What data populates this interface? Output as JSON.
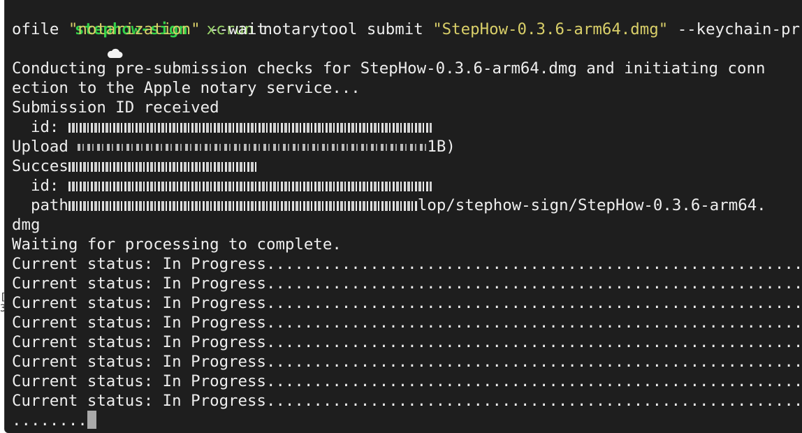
{
  "prompt": {
    "directory": "stephow-sign",
    "command": "xcrun",
    "args": "notarytool submit",
    "dmg_arg": "\"StepHow-0.3.6-arm64.dmg\"",
    "keychain_flag": "--keychain-pr",
    "keychain_flag_cont": "ofile",
    "profile_arg": "\"notarization\"",
    "wait_flag": "--wait"
  },
  "output": {
    "checks_line1": "Conducting pre-submission checks for StepHow-0.3.6-arm64.dmg and initiating conn",
    "checks_line2": "ection to the Apple notary service...",
    "submission_received": "Submission ID received",
    "id_label": "  id: ",
    "upload_label": "Upload ",
    "upload_tail": "1B)",
    "success_label": "Succes",
    "id2_label": "  id: ",
    "path_label": "  path",
    "path_tail": "lop/stephow-sign/StepHow-0.3.6-arm64.",
    "path_cont": "dmg",
    "waiting": "Waiting for processing to complete.",
    "status_lines": [
      "Current status: In Progress.........................................................",
      "Current status: In Progress.........................................................",
      "Current status: In Progress.........................................................",
      "Current status: In Progress.........................................................",
      "Current status: In Progress.........................................................",
      "Current status: In Progress.........................................................",
      "Current status: In Progress.........................................................",
      "Current status: In Progress........................................................."
    ],
    "last_dots": "........"
  },
  "colors": {
    "background": "#1e1e1e",
    "text": "#eeeeee",
    "prompt_dir": "#33d04a",
    "command": "#9ad46c",
    "string": "#d9cf69",
    "cursor": "#a9a9a9"
  },
  "icons": {
    "prompt_icon": "cloud-icon"
  }
}
